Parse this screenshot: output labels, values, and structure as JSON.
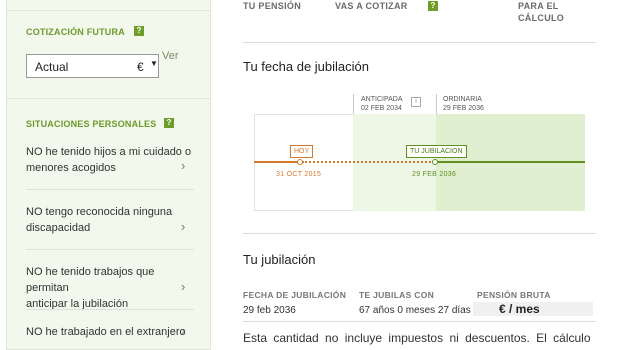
{
  "sidebar": {
    "cotizacion": {
      "title": "COTIZACIÓN FUTURA",
      "help": "?",
      "select_value": "Actual",
      "select_currency": "€",
      "link": "Ver"
    },
    "situaciones": {
      "title": "SITUACIONES PERSONALES",
      "help": "?",
      "items": [
        {
          "line1": "NO he tenido hijos a mi cuidado o",
          "line2": "menores acogidos"
        },
        {
          "line1": "NO tengo reconocida ninguna",
          "line2": "discapacidad"
        },
        {
          "line1": "NO he tenido trabajos que permitan",
          "line2": "anticipar la jubilación"
        },
        {
          "line1": "NO he trabajado en el extranjero",
          "line2": ""
        }
      ]
    }
  },
  "header_row": {
    "col1": "TU PENSIÓN",
    "col2": "VAS A COTIZAR",
    "help": "?",
    "col3_line1": "PARA EL",
    "col3_line2": "CÁLCULO"
  },
  "fecha": {
    "title": "Tu fecha de jubilación",
    "anticipada_label": "ANTICIPADA",
    "anticipada_date": "02 FEB 2034",
    "info": "i",
    "ordinaria_label": "ORDINARIA",
    "ordinaria_date": "29 FEB 2036",
    "hoy_tag": "HOY",
    "hoy_date": "31 OCT 2015",
    "jub_tag": "TU JUBILACION",
    "jub_date": "29 FEB 2036"
  },
  "jubilacion": {
    "title": "Tu jubilación",
    "col1_head": "FECHA DE JUBILACIÓN",
    "col1_val": "29 feb 2036",
    "col2_head": "TE JUBILAS CON",
    "col2_val": "67 años 0 meses 27 días",
    "col3_head": "PENSIÓN BRUTA",
    "col3_val": "€ / mes",
    "disclaimer": "Esta cantidad no incluye impuestos ni descuentos. El cálculo es"
  },
  "colors": {
    "accent_green": "#6e9e2a",
    "orange": "#d4782a",
    "dark_green": "#5f8f1e"
  }
}
